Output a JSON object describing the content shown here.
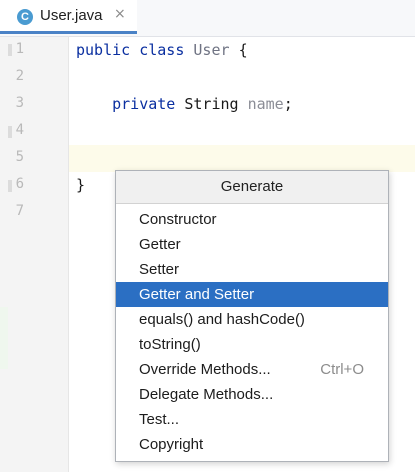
{
  "tab": {
    "icon_letter": "C",
    "label": "User.java",
    "close": "×"
  },
  "gutter": {
    "line_numbers": [
      "1",
      "2",
      "3",
      "4",
      "5",
      "6",
      "7"
    ]
  },
  "code": {
    "line1": {
      "kw1": "public",
      "kw2": "class",
      "name": "User",
      "brace": "{"
    },
    "line3": {
      "kw": "private",
      "type": "String",
      "field": "name",
      "semicolon": ";"
    },
    "line6": {
      "brace": "}"
    }
  },
  "popup": {
    "title": "Generate",
    "items": [
      {
        "label": "Constructor",
        "shortcut": ""
      },
      {
        "label": "Getter",
        "shortcut": ""
      },
      {
        "label": "Setter",
        "shortcut": ""
      },
      {
        "label": "Getter and Setter",
        "shortcut": "",
        "selected": true
      },
      {
        "label": "equals() and hashCode()",
        "shortcut": ""
      },
      {
        "label": "toString()",
        "shortcut": ""
      },
      {
        "label": "Override Methods...",
        "shortcut": "Ctrl+O"
      },
      {
        "label": "Delegate Methods...",
        "shortcut": ""
      },
      {
        "label": "Test...",
        "shortcut": ""
      },
      {
        "label": "Copyright",
        "shortcut": ""
      }
    ]
  },
  "colors": {
    "keyword": "#0a2fa0",
    "selection": "#2b6fc3",
    "caret_line": "#fdfbea",
    "tab_underline": "#4a82c6",
    "file_icon": "#4a9bd1"
  }
}
